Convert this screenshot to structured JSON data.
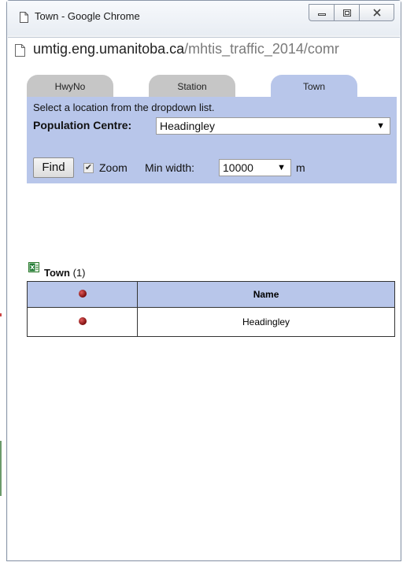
{
  "window": {
    "title": "Town - Google Chrome",
    "url_host": "umtig.eng.umanitoba.ca",
    "url_path": "/mhtis_traffic_2014/comr"
  },
  "tabs": [
    {
      "label": "HwyNo",
      "active": false
    },
    {
      "label": "Station",
      "active": false
    },
    {
      "label": "Town",
      "active": true
    }
  ],
  "form": {
    "instruction": "Select a location from the dropdown list.",
    "population_label": "Population Centre:",
    "population_value": "Headingley",
    "find_label": "Find",
    "zoom_checked": true,
    "zoom_label": "Zoom",
    "min_width_label": "Min width:",
    "min_width_value": "10000",
    "unit": "m"
  },
  "results": {
    "title": "Town",
    "count": "(1)",
    "columns": [
      "",
      "Name"
    ],
    "rows": [
      {
        "name": "Headingley"
      }
    ]
  },
  "colors": {
    "panel": "#b8c6ea",
    "tab_inactive": "#c6c6c6"
  },
  "icons": [
    "document-icon",
    "minimize-icon",
    "maximize-icon",
    "close-icon",
    "page-icon",
    "excel-export-icon",
    "map-marker-icon",
    "dropdown-arrow-icon",
    "checkmark-icon"
  ]
}
